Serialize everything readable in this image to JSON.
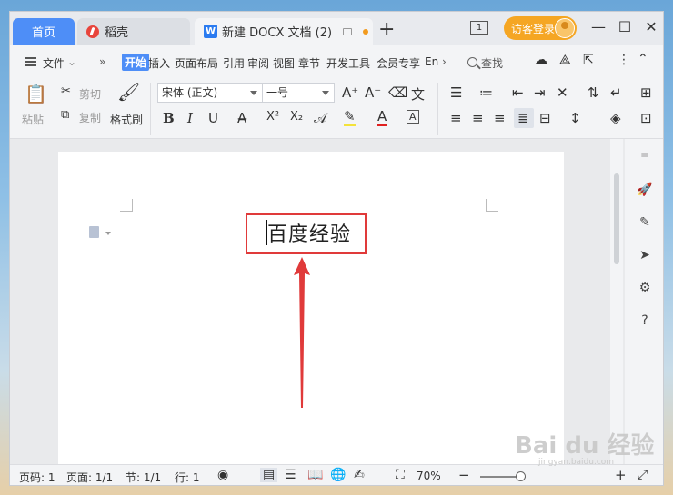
{
  "titlebar": {
    "home_tab": "首页",
    "tab_daoke": "稻壳",
    "tab_doc": "新建 DOCX 文档 (2)",
    "new_tab_icon": "+",
    "window_count": "1",
    "login_label": "访客登录",
    "minimize_icon": "—",
    "maximize_icon": "☐",
    "close_icon": "✕"
  },
  "menubar": {
    "file_label": "文件",
    "more": "»",
    "tabs": [
      "开始",
      "插入",
      "页面布局",
      "引用",
      "审阅",
      "视图",
      "章节",
      "开发工具",
      "会员专享",
      "En"
    ],
    "search_label": "查找"
  },
  "toolbar": {
    "paste": "粘贴",
    "cut": "剪切",
    "copy": "复制",
    "format_painter": "格式刷",
    "font_name": "宋体 (正文)",
    "font_size": "一号",
    "bold": "B",
    "italic": "I",
    "underline": "U",
    "superscript": "X²",
    "subscript": "X₂"
  },
  "document": {
    "text": "百度经验"
  },
  "statusbar": {
    "page_num": "页码: 1",
    "pages": "页面: 1/1",
    "section": "节: 1/1",
    "line": "行: 1",
    "zoom": "70%",
    "zoom_minus": "−",
    "zoom_plus": "+"
  },
  "watermark": {
    "logo": "Bai du 经验",
    "url": "jingyan.baidu.com"
  },
  "colors": {
    "accent": "#4e8ef7",
    "login": "#f5a623",
    "annotation": "#e03a3a"
  }
}
